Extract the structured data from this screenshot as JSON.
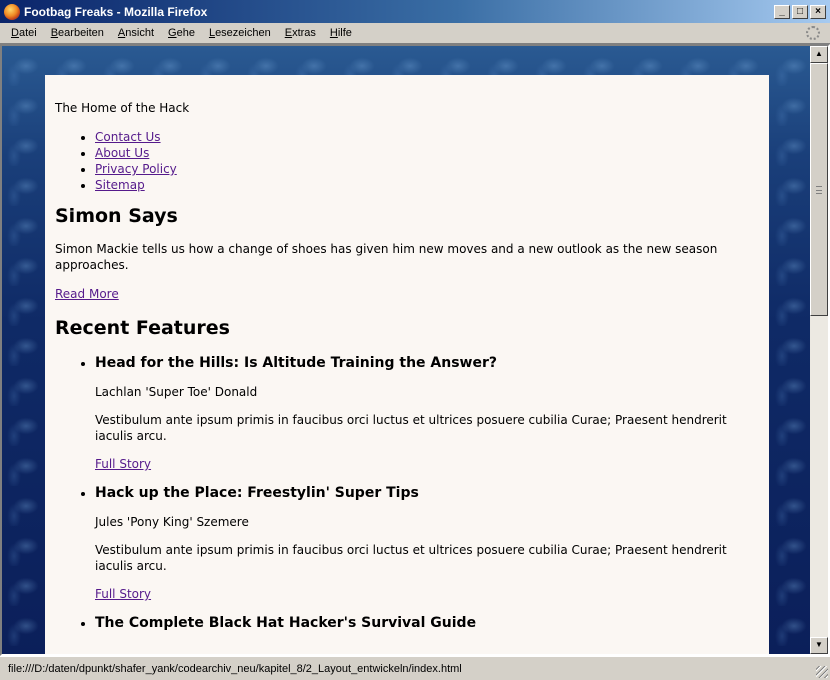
{
  "window": {
    "title": "Footbag Freaks - Mozilla Firefox",
    "buttons": {
      "minimize": "_",
      "maximize": "□",
      "close": "×"
    }
  },
  "menu": {
    "items": [
      {
        "label": "Datei",
        "accel": "D",
        "rest": "atei"
      },
      {
        "label": "Bearbeiten",
        "accel": "B",
        "rest": "earbeiten"
      },
      {
        "label": "Ansicht",
        "accel": "A",
        "rest": "nsicht"
      },
      {
        "label": "Gehe",
        "accel": "G",
        "rest": "ehe"
      },
      {
        "label": "Lesezeichen",
        "accel": "L",
        "rest": "esezeichen"
      },
      {
        "label": "Extras",
        "accel": "E",
        "rest": "xtras"
      },
      {
        "label": "Hilfe",
        "accel": "H",
        "rest": "ilfe"
      }
    ]
  },
  "page": {
    "tagline": "The Home of the Hack",
    "nav": [
      "Contact Us",
      "About Us",
      "Privacy Policy",
      "Sitemap"
    ],
    "simon": {
      "heading": "Simon Says",
      "text": "Simon Mackie tells us how a change of shoes has given him new moves and a new outlook as the new season approaches.",
      "link": "Read More"
    },
    "recent": {
      "heading": "Recent Features",
      "items": [
        {
          "title": "Head for the Hills: Is Altitude Training the Answer?",
          "author": "Lachlan 'Super Toe' Donald",
          "summary": "Vestibulum ante ipsum primis in faucibus orci luctus et ultrices posuere cubilia Curae; Praesent hendrerit iaculis arcu.",
          "link": "Full Story"
        },
        {
          "title": "Hack up the Place: Freestylin' Super Tips",
          "author": "Jules 'Pony King' Szemere",
          "summary": "Vestibulum ante ipsum primis in faucibus orci luctus et ultrices posuere cubilia Curae; Praesent hendrerit iaculis arcu.",
          "link": "Full Story"
        },
        {
          "title": "The Complete Black Hat Hacker's Survival Guide",
          "author": "",
          "summary": "",
          "link": ""
        }
      ]
    }
  },
  "status": {
    "url": "file:///D:/daten/dpunkt/shafer_yank/codearchiv_neu/kapitel_8/2_Layout_entwickeln/index.html"
  },
  "scroll": {
    "position_fraction": 0.0,
    "visible_fraction": 0.44
  }
}
